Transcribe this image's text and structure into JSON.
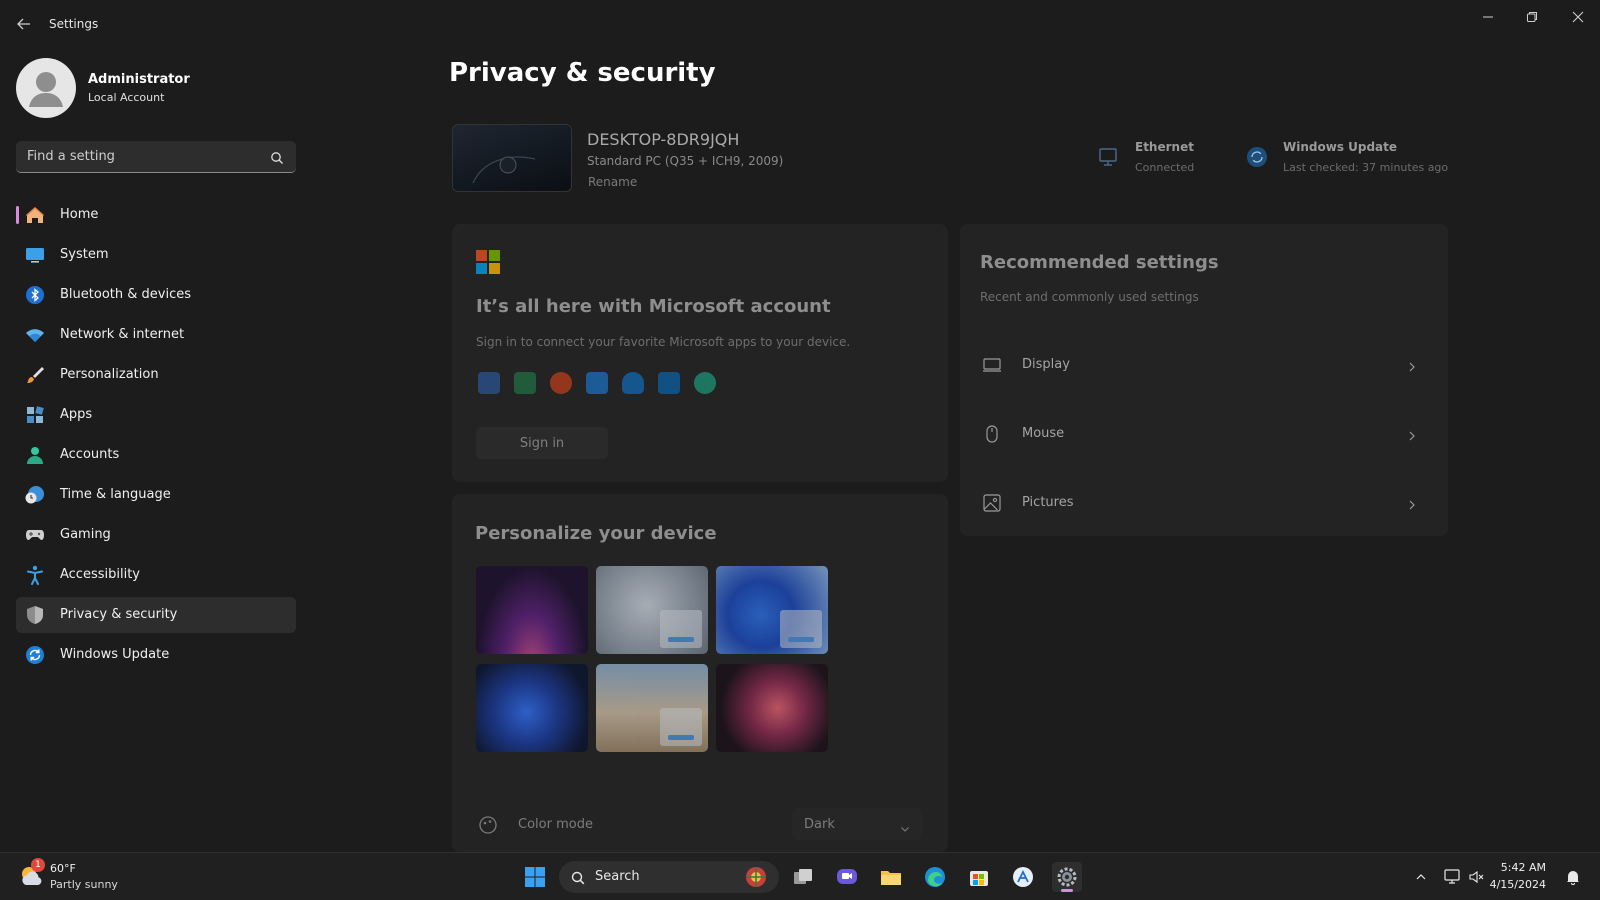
{
  "window": {
    "title": "Settings"
  },
  "profile": {
    "name": "Administrator",
    "account_type": "Local Account"
  },
  "search": {
    "placeholder": "Find a setting"
  },
  "nav": [
    {
      "label": "Home",
      "icon": "home-icon"
    },
    {
      "label": "System",
      "icon": "system-icon"
    },
    {
      "label": "Bluetooth & devices",
      "icon": "bluetooth-icon"
    },
    {
      "label": "Network & internet",
      "icon": "wifi-icon"
    },
    {
      "label": "Personalization",
      "icon": "brush-icon"
    },
    {
      "label": "Apps",
      "icon": "apps-icon"
    },
    {
      "label": "Accounts",
      "icon": "person-icon"
    },
    {
      "label": "Time & language",
      "icon": "clock-globe-icon"
    },
    {
      "label": "Gaming",
      "icon": "gamepad-icon"
    },
    {
      "label": "Accessibility",
      "icon": "accessibility-icon"
    },
    {
      "label": "Privacy & security",
      "icon": "shield-icon"
    },
    {
      "label": "Windows Update",
      "icon": "update-icon"
    }
  ],
  "main": {
    "title": "Privacy & security",
    "device": {
      "name": "DESKTOP-8DR9JQH",
      "spec": "Standard PC (Q35 + ICH9, 2009)",
      "rename": "Rename"
    },
    "status": {
      "ethernet": {
        "title": "Ethernet",
        "sub": "Connected"
      },
      "update": {
        "title": "Windows Update",
        "sub": "Last checked: 37 minutes ago"
      }
    },
    "ms_account": {
      "heading": "It’s all here with Microsoft account",
      "sub": "Sign in to connect your favorite Microsoft apps to your device.",
      "sign_in": "Sign in"
    },
    "personalize": {
      "heading": "Personalize your device",
      "color_mode_label": "Color mode",
      "color_mode_value": "Dark"
    },
    "recommended": {
      "heading": "Recommended settings",
      "sub": "Recent and commonly used settings",
      "items": [
        {
          "label": "Display",
          "icon": "monitor-icon"
        },
        {
          "label": "Mouse",
          "icon": "mouse-icon"
        },
        {
          "label": "Pictures",
          "icon": "image-icon"
        }
      ]
    }
  },
  "taskbar": {
    "weather": {
      "temp": "60°F",
      "desc": "Partly sunny",
      "badge": "1"
    },
    "search_label": "Search",
    "time": "5:42 AM",
    "date": "4/15/2024"
  },
  "colors": {
    "accent": "#d98ad9",
    "background": "#1c1c1c",
    "card": "#232323"
  }
}
